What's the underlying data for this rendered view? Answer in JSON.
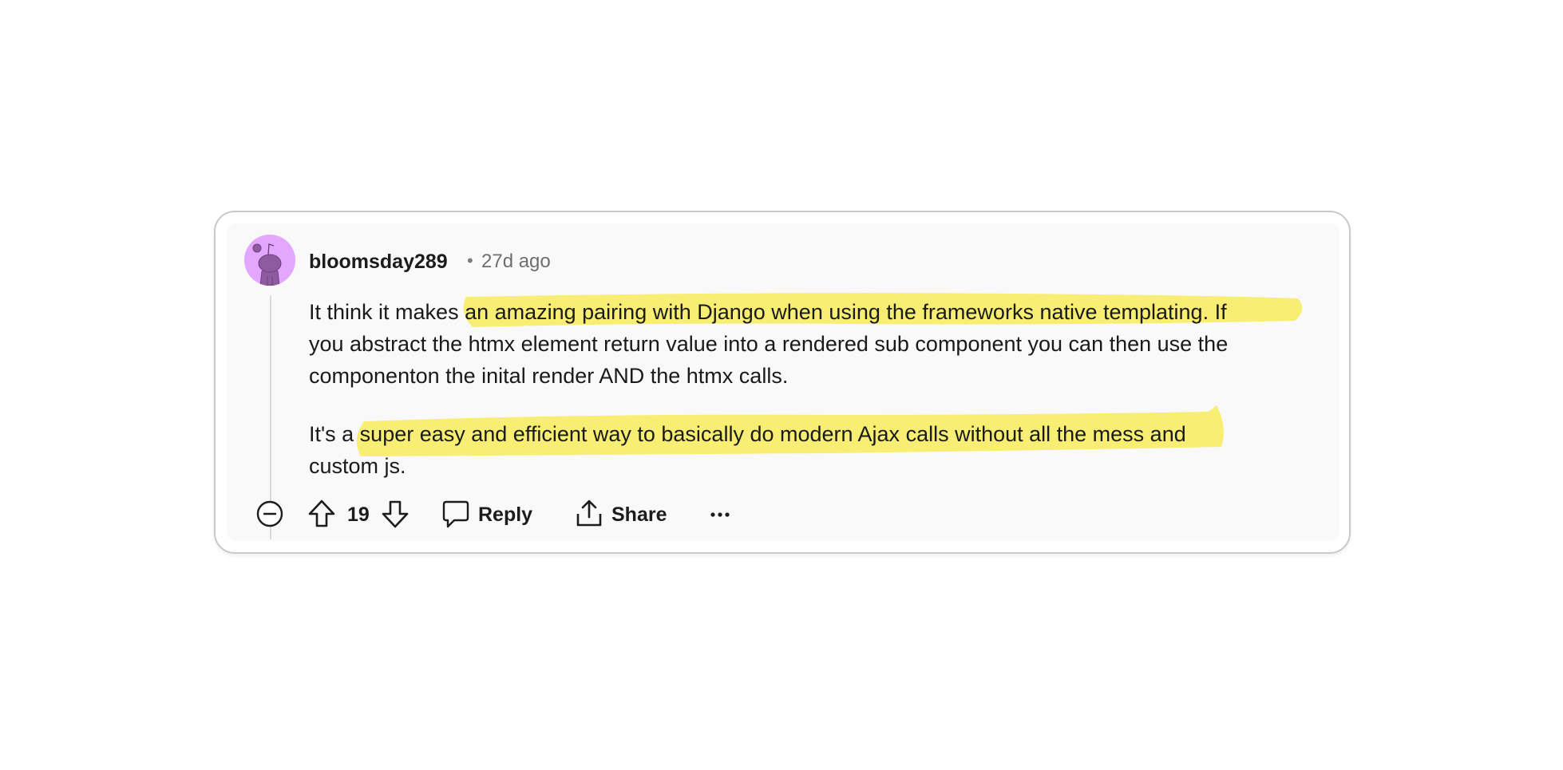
{
  "comment": {
    "username": "bloomsday289",
    "separator": "•",
    "timestamp": "27d ago",
    "paragraph1_lines": [
      "It think it makes an amazing pairing with Django when using the frameworks native templating. If",
      "you abstract the htmx element return value into a rendered sub component you can then use the",
      "componenton the inital render AND the htmx calls."
    ],
    "paragraph2_lines": [
      "It's a super easy and efficient way to basically do modern Ajax calls without all the mess and",
      "custom js."
    ],
    "highlight_color": "#f7ed6b"
  },
  "actions": {
    "collapse_icon": "minus-circle-icon",
    "upvote_icon": "arrow-up-icon",
    "vote_count": "19",
    "downvote_icon": "arrow-down-icon",
    "reply_label": "Reply",
    "reply_icon": "speech-bubble-icon",
    "share_label": "Share",
    "share_icon": "share-icon",
    "more_icon": "ellipsis-icon"
  },
  "colors": {
    "avatar_bg": "#e4a7ff",
    "avatar_figure": "#8f5b9f",
    "card_border": "#c9c9c9",
    "inner_bg": "#f9f9f9"
  }
}
